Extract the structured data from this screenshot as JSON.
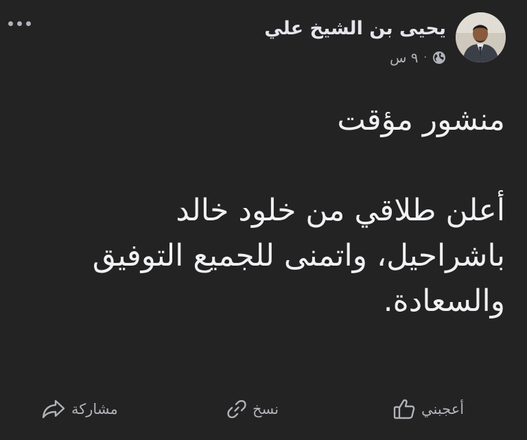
{
  "author": {
    "name": "يحيى بن الشيخ علي",
    "time": "٩ س",
    "separator": "·",
    "audience_icon": "globe-icon"
  },
  "menu": {
    "icon": "more-options-icon"
  },
  "post": {
    "title": "منشور مؤقت",
    "body_lines": [
      "أعلن طلاقي من خلود خالد",
      "باشراحيل، واتمنى للجميع التوفيق",
      "والسعادة."
    ]
  },
  "actions": {
    "like": {
      "label": "أعجبني",
      "icon": "thumbs-up-icon"
    },
    "copy": {
      "label": "نسخ",
      "icon": "link-icon"
    },
    "share": {
      "label": "مشاركة",
      "icon": "share-icon"
    }
  },
  "colors": {
    "background": "#232324",
    "primary_text": "#e4e6eb",
    "secondary_text": "#b0b3b8"
  }
}
